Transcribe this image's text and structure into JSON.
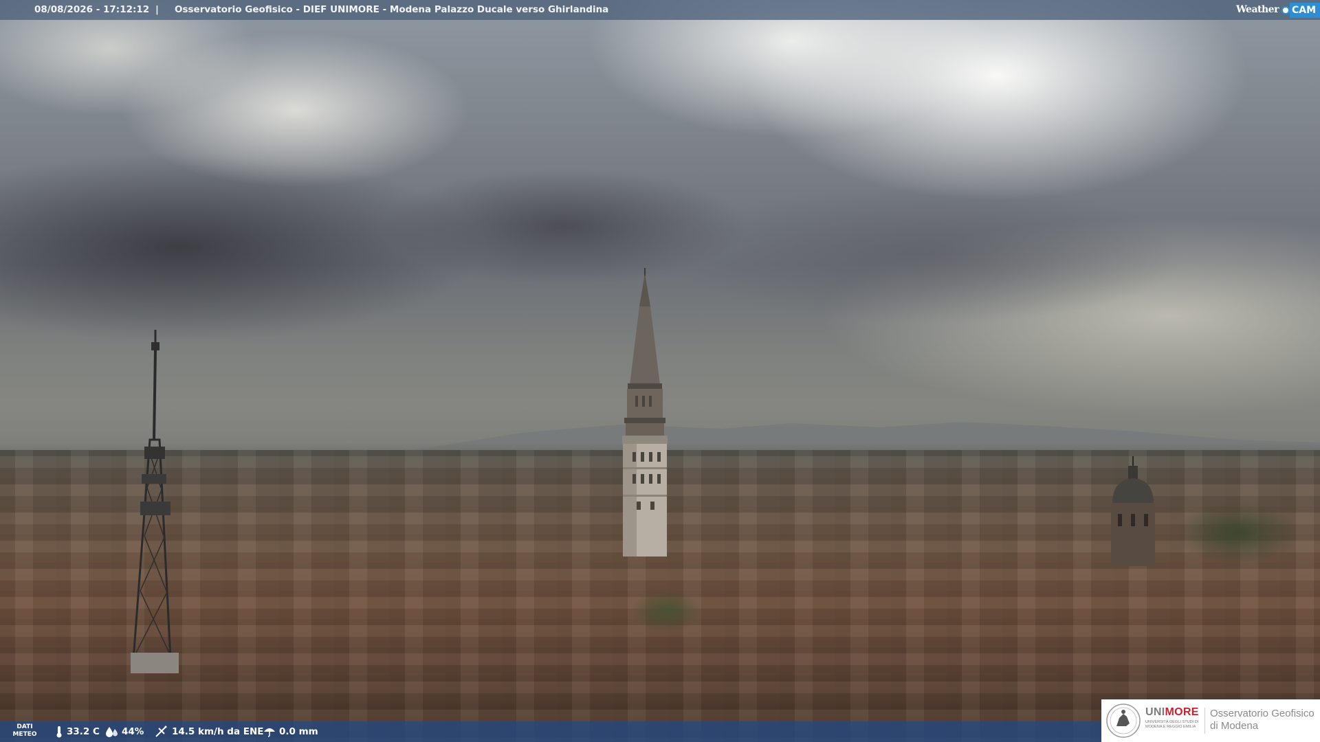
{
  "header": {
    "datetime": "08/08/2026 - 17:12:12",
    "separator": "|",
    "title": "Osservatorio Geofisico - DIEF UNIMORE - Modena Palazzo Ducale verso Ghirlandina"
  },
  "brand": {
    "weather": "Weather",
    "cam": "CAM",
    "accent_color": "#2c8fd6"
  },
  "meteo": {
    "label_line1": "DATI",
    "label_line2": "METEO",
    "temperature": "33.2 C",
    "humidity": "44%",
    "wind": "14.5 km/h da ENE",
    "rain": "0.0 mm"
  },
  "logo": {
    "uni_part1": "UNI",
    "uni_part2": "MORE",
    "university": "Università degli studi di Modena e Reggio Emilia",
    "observatory_line1": "Osservatorio Geofisico",
    "observatory_line2": "di Modena",
    "uni_gray": "#7b7b7b",
    "uni_red": "#c8202e"
  }
}
